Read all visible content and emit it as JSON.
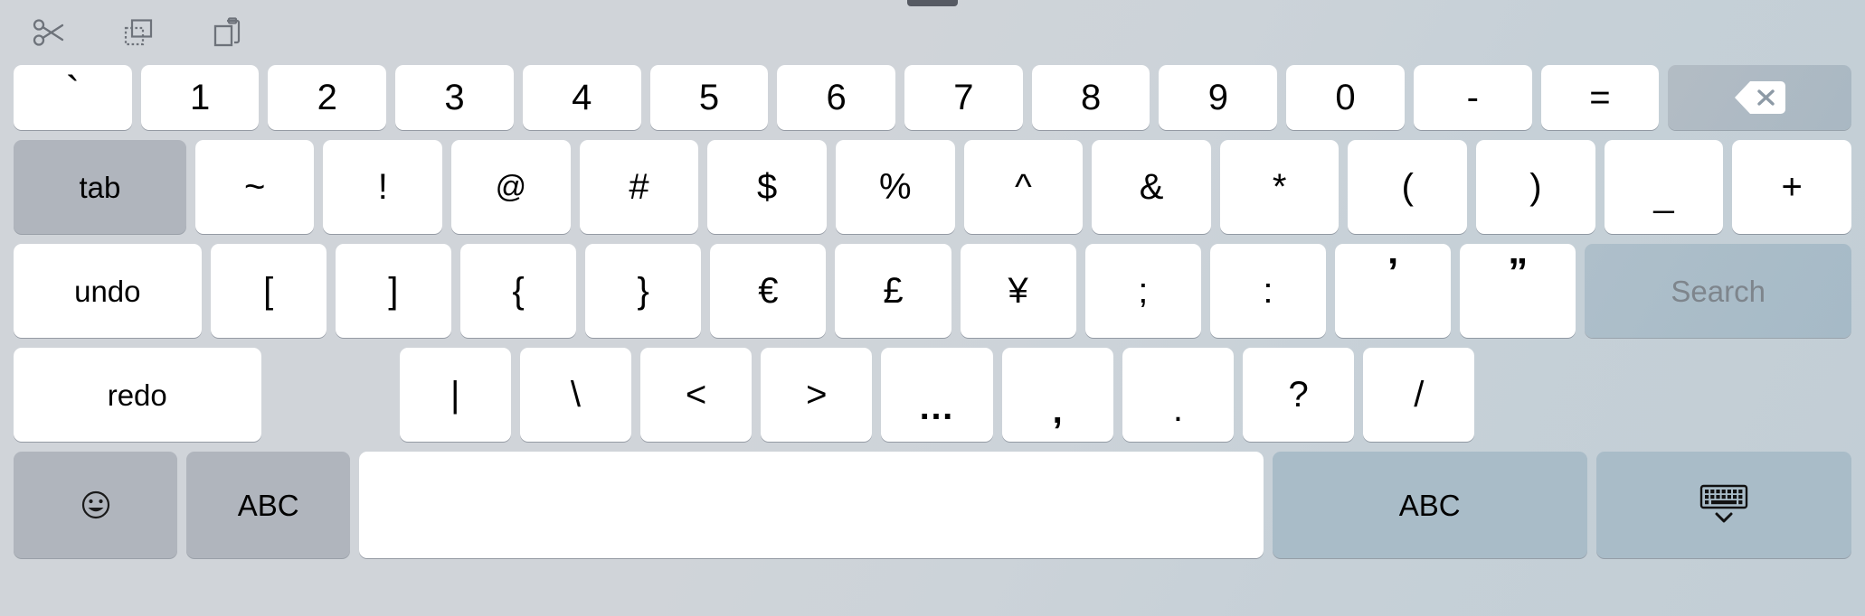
{
  "keyboard": {
    "type": "ios-symbols-keyboard",
    "background_color": "#ccd1d7",
    "key_color": "#ffffff",
    "modifier_key_color": "#b0b5bd",
    "accent_key_color": "#a9bcc8"
  },
  "toolbar": {
    "items": [
      {
        "name": "cut",
        "icon": "scissors-icon"
      },
      {
        "name": "copy",
        "icon": "copy-icon"
      },
      {
        "name": "paste",
        "icon": "paste-icon"
      }
    ]
  },
  "rows": {
    "row1": [
      {
        "label": "`",
        "name": "key-backtick",
        "style": "tick"
      },
      {
        "label": "1",
        "name": "key-1",
        "style": ""
      },
      {
        "label": "2",
        "name": "key-2",
        "style": ""
      },
      {
        "label": "3",
        "name": "key-3",
        "style": ""
      },
      {
        "label": "4",
        "name": "key-4",
        "style": ""
      },
      {
        "label": "5",
        "name": "key-5",
        "style": ""
      },
      {
        "label": "6",
        "name": "key-6",
        "style": ""
      },
      {
        "label": "7",
        "name": "key-7",
        "style": ""
      },
      {
        "label": "8",
        "name": "key-8",
        "style": ""
      },
      {
        "label": "9",
        "name": "key-9",
        "style": ""
      },
      {
        "label": "0",
        "name": "key-0",
        "style": ""
      },
      {
        "label": "-",
        "name": "key-hyphen",
        "style": ""
      },
      {
        "label": "=",
        "name": "key-equals",
        "style": ""
      }
    ],
    "backspace": {
      "label": "",
      "name": "backspace-key",
      "icon": "delete-left-icon"
    },
    "row2": [
      {
        "label": "~",
        "name": "key-tilde",
        "style": ""
      },
      {
        "label": "!",
        "name": "key-exclamation",
        "style": ""
      },
      {
        "label": "@",
        "name": "key-at",
        "style": "sm"
      },
      {
        "label": "#",
        "name": "key-hash",
        "style": ""
      },
      {
        "label": "$",
        "name": "key-dollar",
        "style": ""
      },
      {
        "label": "%",
        "name": "key-percent",
        "style": ""
      },
      {
        "label": "^",
        "name": "key-caret",
        "style": ""
      },
      {
        "label": "&",
        "name": "key-ampersand",
        "style": ""
      },
      {
        "label": "*",
        "name": "key-asterisk",
        "style": ""
      },
      {
        "label": "(",
        "name": "key-paren-open",
        "style": ""
      },
      {
        "label": ")",
        "name": "key-paren-close",
        "style": ""
      },
      {
        "label": "_",
        "name": "key-underscore",
        "style": "under"
      },
      {
        "label": "+",
        "name": "key-plus",
        "style": ""
      }
    ],
    "tab": {
      "label": "tab",
      "name": "tab-key"
    },
    "row3": [
      {
        "label": "[",
        "name": "key-bracket-open",
        "style": ""
      },
      {
        "label": "]",
        "name": "key-bracket-close",
        "style": ""
      },
      {
        "label": "{",
        "name": "key-brace-open",
        "style": ""
      },
      {
        "label": "}",
        "name": "key-brace-close",
        "style": ""
      },
      {
        "label": "€",
        "name": "key-euro",
        "style": ""
      },
      {
        "label": "£",
        "name": "key-pound",
        "style": ""
      },
      {
        "label": "¥",
        "name": "key-yen",
        "style": ""
      },
      {
        "label": ";",
        "name": "key-semicolon",
        "style": ""
      },
      {
        "label": ":",
        "name": "key-colon",
        "style": ""
      },
      {
        "label": "’",
        "name": "key-apostrophe",
        "style": "quote"
      },
      {
        "label": "”",
        "name": "key-quote",
        "style": "quote"
      }
    ],
    "undo": {
      "label": "undo",
      "name": "undo-key"
    },
    "search": {
      "label": "Search",
      "name": "search-key"
    },
    "row4": [
      {
        "label": "|",
        "name": "key-pipe",
        "style": ""
      },
      {
        "label": "\\",
        "name": "key-backslash",
        "style": ""
      },
      {
        "label": "<",
        "name": "key-less-than",
        "style": ""
      },
      {
        "label": ">",
        "name": "key-greater-than",
        "style": ""
      },
      {
        "label": "…",
        "name": "key-ellipsis",
        "style": "ell"
      },
      {
        "label": ",",
        "name": "key-comma",
        "style": "comma"
      },
      {
        "label": ".",
        "name": "key-period",
        "style": "dot"
      },
      {
        "label": "?",
        "name": "key-question",
        "style": ""
      },
      {
        "label": "/",
        "name": "key-slash",
        "style": ""
      }
    ],
    "redo": {
      "label": "redo",
      "name": "redo-key"
    },
    "bottom": {
      "emoji": {
        "label": "",
        "name": "emoji-key",
        "icon": "smiley-icon"
      },
      "abc_left": {
        "label": "ABC",
        "name": "abc-left-key"
      },
      "space": {
        "label": "",
        "name": "space-key"
      },
      "abc_right": {
        "label": "ABC",
        "name": "abc-right-key"
      },
      "dismiss": {
        "label": "",
        "name": "dismiss-keyboard-key",
        "icon": "keyboard-down-icon"
      }
    }
  }
}
